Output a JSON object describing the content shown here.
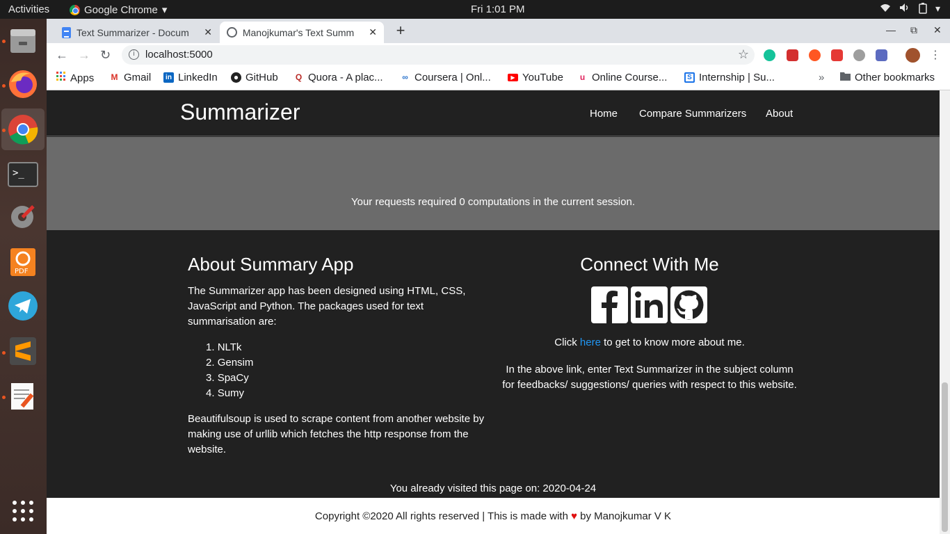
{
  "os": {
    "activities": "Activities",
    "app_menu": "Google Chrome",
    "clock": "Fri  1:01 PM"
  },
  "browser": {
    "tabs": [
      {
        "title": "Text Summarizer - Docum",
        "icon": "docs-icon",
        "active": false
      },
      {
        "title": "Manojkumar's Text Summ",
        "icon": "globe-icon",
        "active": true
      }
    ],
    "url": "localhost:5000",
    "bookmarks": [
      {
        "label": "Apps"
      },
      {
        "label": "Gmail"
      },
      {
        "label": "LinkedIn"
      },
      {
        "label": "GitHub"
      },
      {
        "label": "Quora - A plac..."
      },
      {
        "label": "Coursera | Onl..."
      },
      {
        "label": "YouTube"
      },
      {
        "label": "Online Course..."
      },
      {
        "label": "Internship | Su..."
      }
    ],
    "more_bookmarks": "»",
    "other_bookmarks": "Other bookmarks"
  },
  "site": {
    "brand": "Summarizer",
    "nav": [
      "Home",
      "Compare Summarizers",
      "About"
    ],
    "computations": "Your requests required 0 computations in the current session.",
    "about": {
      "title": "About Summary App",
      "text": "The Summarizer app has been designed using HTML, CSS, JavaScript and Python. The packages used for text summarisation are:",
      "packages": [
        "NLTk",
        "Gensim",
        "SpaCy",
        "Sumy"
      ],
      "scrape_text": "Beautifulsoup is used to scrape content from another website by making use of urllib which fetches the http response from the website."
    },
    "connect": {
      "title": "Connect With Me",
      "social_icons": [
        "facebook-icon",
        "linkedin-icon",
        "github-icon"
      ],
      "click_prefix": "Click ",
      "link_text": "here",
      "click_suffix": " to get to know more about me.",
      "feedback": "In the above link, enter Text Summarizer in the subject column for feedbacks/ suggestions/ queries with respect to this website."
    },
    "visited": "You already visited this page on: 2020-04-24",
    "copyright_prefix": "Copyright ©2020 All rights reserved | This is made with",
    "copyright_suffix": "by Manojkumar V K"
  },
  "colors": {
    "navbar_bg": "#212121",
    "gray_section": "#6b6b6b",
    "link": "#2196f3",
    "heart": "#e01010"
  }
}
